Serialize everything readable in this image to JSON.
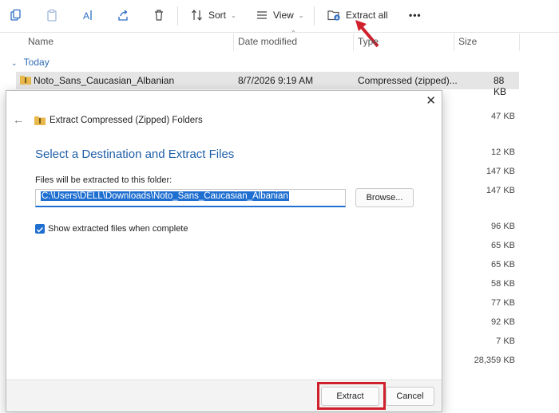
{
  "toolbar": {
    "sort_label": "Sort",
    "view_label": "View",
    "extract_all_label": "Extract all",
    "more_label": "•••"
  },
  "columns": {
    "name": "Name",
    "date_modified": "Date modified",
    "type": "Type",
    "size": "Size"
  },
  "group": {
    "label": "Today"
  },
  "selected_file": {
    "name": "Noto_Sans_Caucasian_Albanian",
    "date": "8/7/2026 9:19 AM",
    "type": "Compressed (zipped)...",
    "size": "88 KB"
  },
  "background_sizes": [
    "47 KB",
    "12 KB",
    "147 KB",
    "147 KB",
    "96 KB",
    "65 KB",
    "65 KB",
    "58 KB",
    "77 KB",
    "92 KB",
    "7 KB",
    "28,359 KB"
  ],
  "dialog": {
    "header_title": "Extract Compressed (Zipped) Folders",
    "heading": "Select a Destination and Extract Files",
    "path_label": "Files will be extracted to this folder:",
    "path_value": "C:\\Users\\DELL\\Downloads\\Noto_Sans_Caucasian_Albanian",
    "browse_label": "Browse...",
    "checkbox_label": "Show extracted files when complete",
    "checkbox_checked": true,
    "extract_label": "Extract",
    "cancel_label": "Cancel"
  },
  "colors": {
    "accent": "#1f6fd0",
    "highlight_red": "#d0202b",
    "heading_blue": "#1f5fa8"
  }
}
